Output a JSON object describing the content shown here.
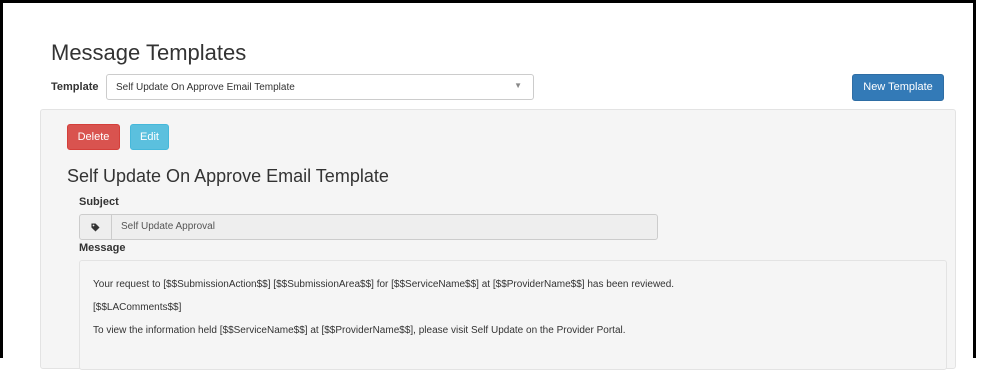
{
  "page": {
    "title": "Message Templates"
  },
  "template_picker": {
    "label": "Template",
    "selected": "Self Update On Approve Email Template",
    "caret": "▼",
    "new_button_label": "New Template"
  },
  "actions": {
    "delete_label": "Delete",
    "edit_label": "Edit"
  },
  "detail": {
    "title": "Self Update On Approve Email Template",
    "subject_label": "Subject",
    "subject_icon": "tag-icon",
    "subject_value": "Self Update Approval",
    "message_label": "Message",
    "message_lines": [
      "Your request to [$$SubmissionAction$$] [$$SubmissionArea$$] for [$$ServiceName$$] at [$$ProviderName$$] has been reviewed.",
      "[$$LAComments$$]",
      "To view the information held [$$ServiceName$$] at [$$ProviderName$$], please visit Self Update on the Provider Portal."
    ]
  },
  "colors": {
    "primary": "#337ab7",
    "danger": "#d9534f",
    "info": "#5bc0de",
    "panel_bg": "#f5f5f5"
  }
}
